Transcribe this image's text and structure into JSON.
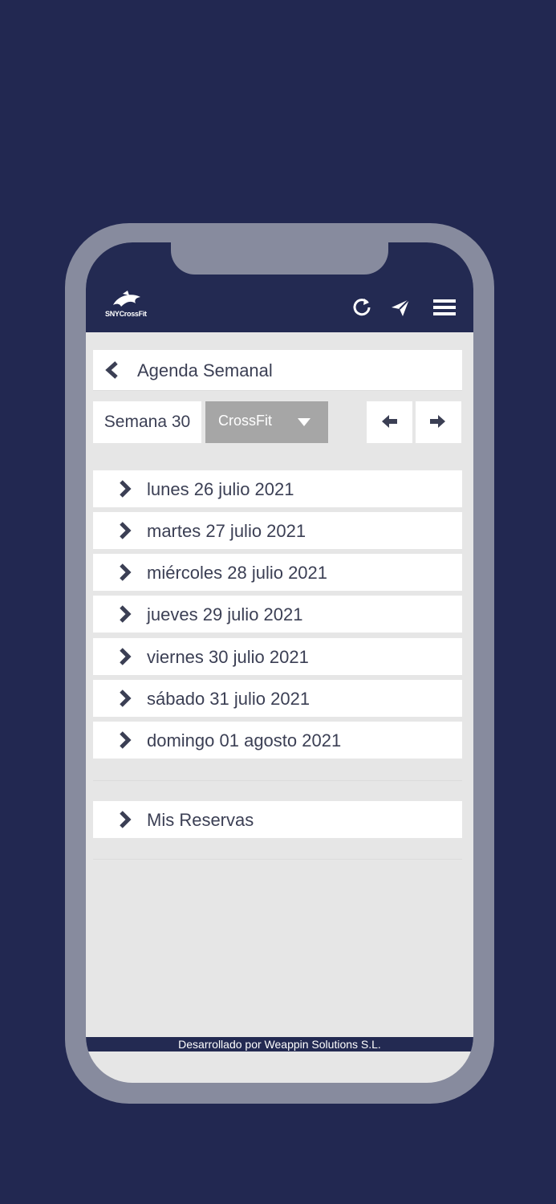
{
  "colors": {
    "background": "#222851",
    "header": "#232a52",
    "screen": "#e6e6e6",
    "frame": "#878b9e",
    "select": "#a6a6a6",
    "text": "#3b3f54"
  },
  "header": {
    "logo_text": "SNYCrossFit",
    "icons": [
      "refresh-icon",
      "send-icon",
      "menu-icon"
    ]
  },
  "page": {
    "title": "Agenda Semanal",
    "back_icon": "chevron-left-icon"
  },
  "toolbar": {
    "week_label": "Semana 30",
    "activity_selected": "CrossFit",
    "prev_icon": "arrow-left-icon",
    "next_icon": "arrow-right-icon"
  },
  "days": [
    {
      "label": "lunes 26 julio 2021"
    },
    {
      "label": "martes 27 julio 2021"
    },
    {
      "label": "miércoles 28 julio 2021"
    },
    {
      "label": "jueves 29 julio 2021"
    },
    {
      "label": "viernes 30 julio 2021"
    },
    {
      "label": "sábado 31 julio 2021"
    },
    {
      "label": "domingo 01 agosto 2021"
    }
  ],
  "reservations": {
    "label": "Mis Reservas"
  },
  "footer": {
    "text": "Desarrollado por Weappin Solutions S.L."
  }
}
